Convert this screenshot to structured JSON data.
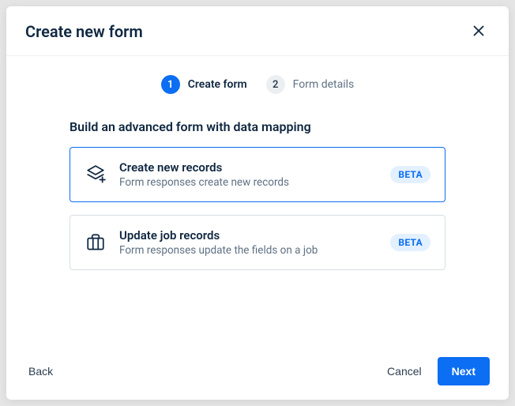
{
  "modal": {
    "title": "Create new form"
  },
  "stepper": {
    "steps": [
      {
        "num": "1",
        "label": "Create form",
        "active": true
      },
      {
        "num": "2",
        "label": "Form details",
        "active": false
      }
    ]
  },
  "section_title": "Build an advanced form with data mapping",
  "options": [
    {
      "title": "Create new records",
      "desc": "Form responses create new records",
      "badge": "BETA",
      "selected": true
    },
    {
      "title": "Update job records",
      "desc": "Form responses update the fields on a job",
      "badge": "BETA",
      "selected": false
    }
  ],
  "footer": {
    "back": "Back",
    "cancel": "Cancel",
    "next": "Next"
  }
}
